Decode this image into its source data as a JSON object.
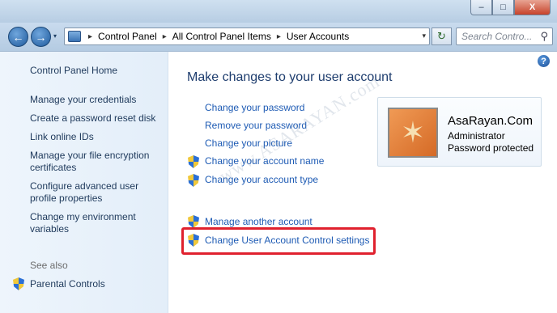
{
  "window": {
    "minimize_label": "–",
    "maximize_label": "□",
    "close_label": "X"
  },
  "nav": {
    "back_label": "←",
    "forward_label": "→",
    "dropdown_label": "▾",
    "breadcrumbs": [
      "Control Panel",
      "All Control Panel Items",
      "User Accounts"
    ],
    "separator": "▸",
    "address_dropdown": "▾",
    "refresh_label": "↻",
    "search_placeholder": "Search Contro...",
    "search_icon_glyph": "⚲"
  },
  "sidebar": {
    "home": "Control Panel Home",
    "links": [
      "Manage your credentials",
      "Create a password reset disk",
      "Link online IDs",
      "Manage your file encryption certificates",
      "Configure advanced user profile properties",
      "Change my environment variables"
    ],
    "see_also_heading": "See also",
    "see_also_links": [
      "Parental Controls"
    ]
  },
  "main": {
    "title": "Make changes to your user account",
    "tasks": [
      {
        "label": "Change your password",
        "shield": false
      },
      {
        "label": "Remove your password",
        "shield": false
      },
      {
        "label": "Change your picture",
        "shield": false
      },
      {
        "label": "Change your account name",
        "shield": true
      },
      {
        "label": "Change your account type",
        "shield": true
      }
    ],
    "admin_tasks": [
      {
        "label": "Manage another account",
        "shield": true
      },
      {
        "label": "Change User Account Control settings",
        "shield": true
      }
    ],
    "help_label": "?"
  },
  "user": {
    "name": "AsaRayan.Com",
    "role": "Administrator",
    "status": "Password protected",
    "picture_glyph": "✶"
  },
  "watermark": "www.ASARAYAN.com",
  "colors": {
    "link": "#1e5bb4",
    "title": "#1e3d6e",
    "highlight": "#e0212e"
  }
}
